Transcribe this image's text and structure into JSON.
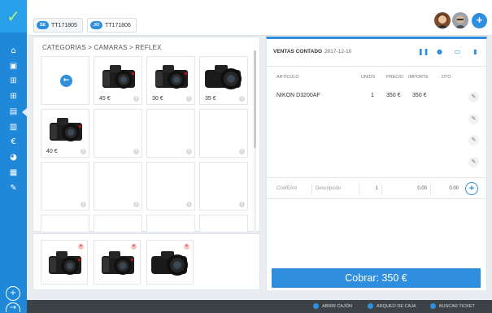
{
  "sidebar": {
    "logo": "✓",
    "items": [
      {
        "icon": "dashboard-icon",
        "glyph": "⌂"
      },
      {
        "icon": "cart-icon",
        "glyph": "▣"
      },
      {
        "icon": "hierarchy-icon",
        "glyph": "⊞"
      },
      {
        "icon": "hierarchy-alt-icon",
        "glyph": "⊞"
      },
      {
        "icon": "pos-icon",
        "glyph": "▤"
      },
      {
        "icon": "bar-chart-icon",
        "glyph": "▥"
      },
      {
        "icon": "euro-icon",
        "glyph": "€"
      },
      {
        "icon": "pie-chart-icon",
        "glyph": "◕"
      },
      {
        "icon": "calendar-icon",
        "glyph": "▦"
      },
      {
        "icon": "wrench-icon",
        "glyph": "✎"
      }
    ],
    "bottom_add": "+",
    "bottom_nav": "→"
  },
  "tabs": [
    {
      "badge": "SE",
      "label": "TT171805"
    },
    {
      "badge": "JO",
      "label": "TT171806"
    }
  ],
  "top_add": "+",
  "breadcrumb": "CATEGORIAS > CAMARAS > REFLEX",
  "products": [
    {
      "type": "back",
      "glyph": "←"
    },
    {
      "type": "camera",
      "price": "45 €",
      "variant": "nikon"
    },
    {
      "type": "camera",
      "price": "30 €",
      "variant": "nikon"
    },
    {
      "type": "camera",
      "price": "35 €",
      "variant": "canon"
    },
    {
      "type": "camera",
      "price": "40 €",
      "variant": "nikon"
    }
  ],
  "favorites": [
    {
      "variant": "nikon"
    },
    {
      "variant": "nikon"
    },
    {
      "variant": "canon"
    }
  ],
  "ticket": {
    "title": "VENTAS CONTADO",
    "date": "2017-12-10",
    "columns": {
      "article": "ARTÍCULO",
      "units": "UNIDS",
      "price": "PRECIO",
      "amount": "IMPORTE",
      "discount": "DTO"
    },
    "lines": [
      {
        "article": "NIKON D3200AF",
        "units": "1",
        "price": "350 €",
        "amount": "350 €",
        "discount": ""
      }
    ],
    "entry": {
      "code_placeholder": "Cód/EAN",
      "desc_placeholder": "Descripción",
      "units": "1",
      "price": "0.00",
      "discount": "0.00"
    },
    "charge_label": "Cobrar: 350 €"
  },
  "bottom_bar": [
    {
      "label": "ABRIR CAJÓN",
      "icon": "drawer-icon"
    },
    {
      "label": "ARQUEO DE CAJA",
      "icon": "cash-count-icon"
    },
    {
      "label": "BUSCAR TICKET",
      "icon": "search-icon"
    }
  ],
  "colors": {
    "accent": "#2f8fde",
    "sidebar": "#1f88d8",
    "logo_check": "#b7f06a"
  }
}
